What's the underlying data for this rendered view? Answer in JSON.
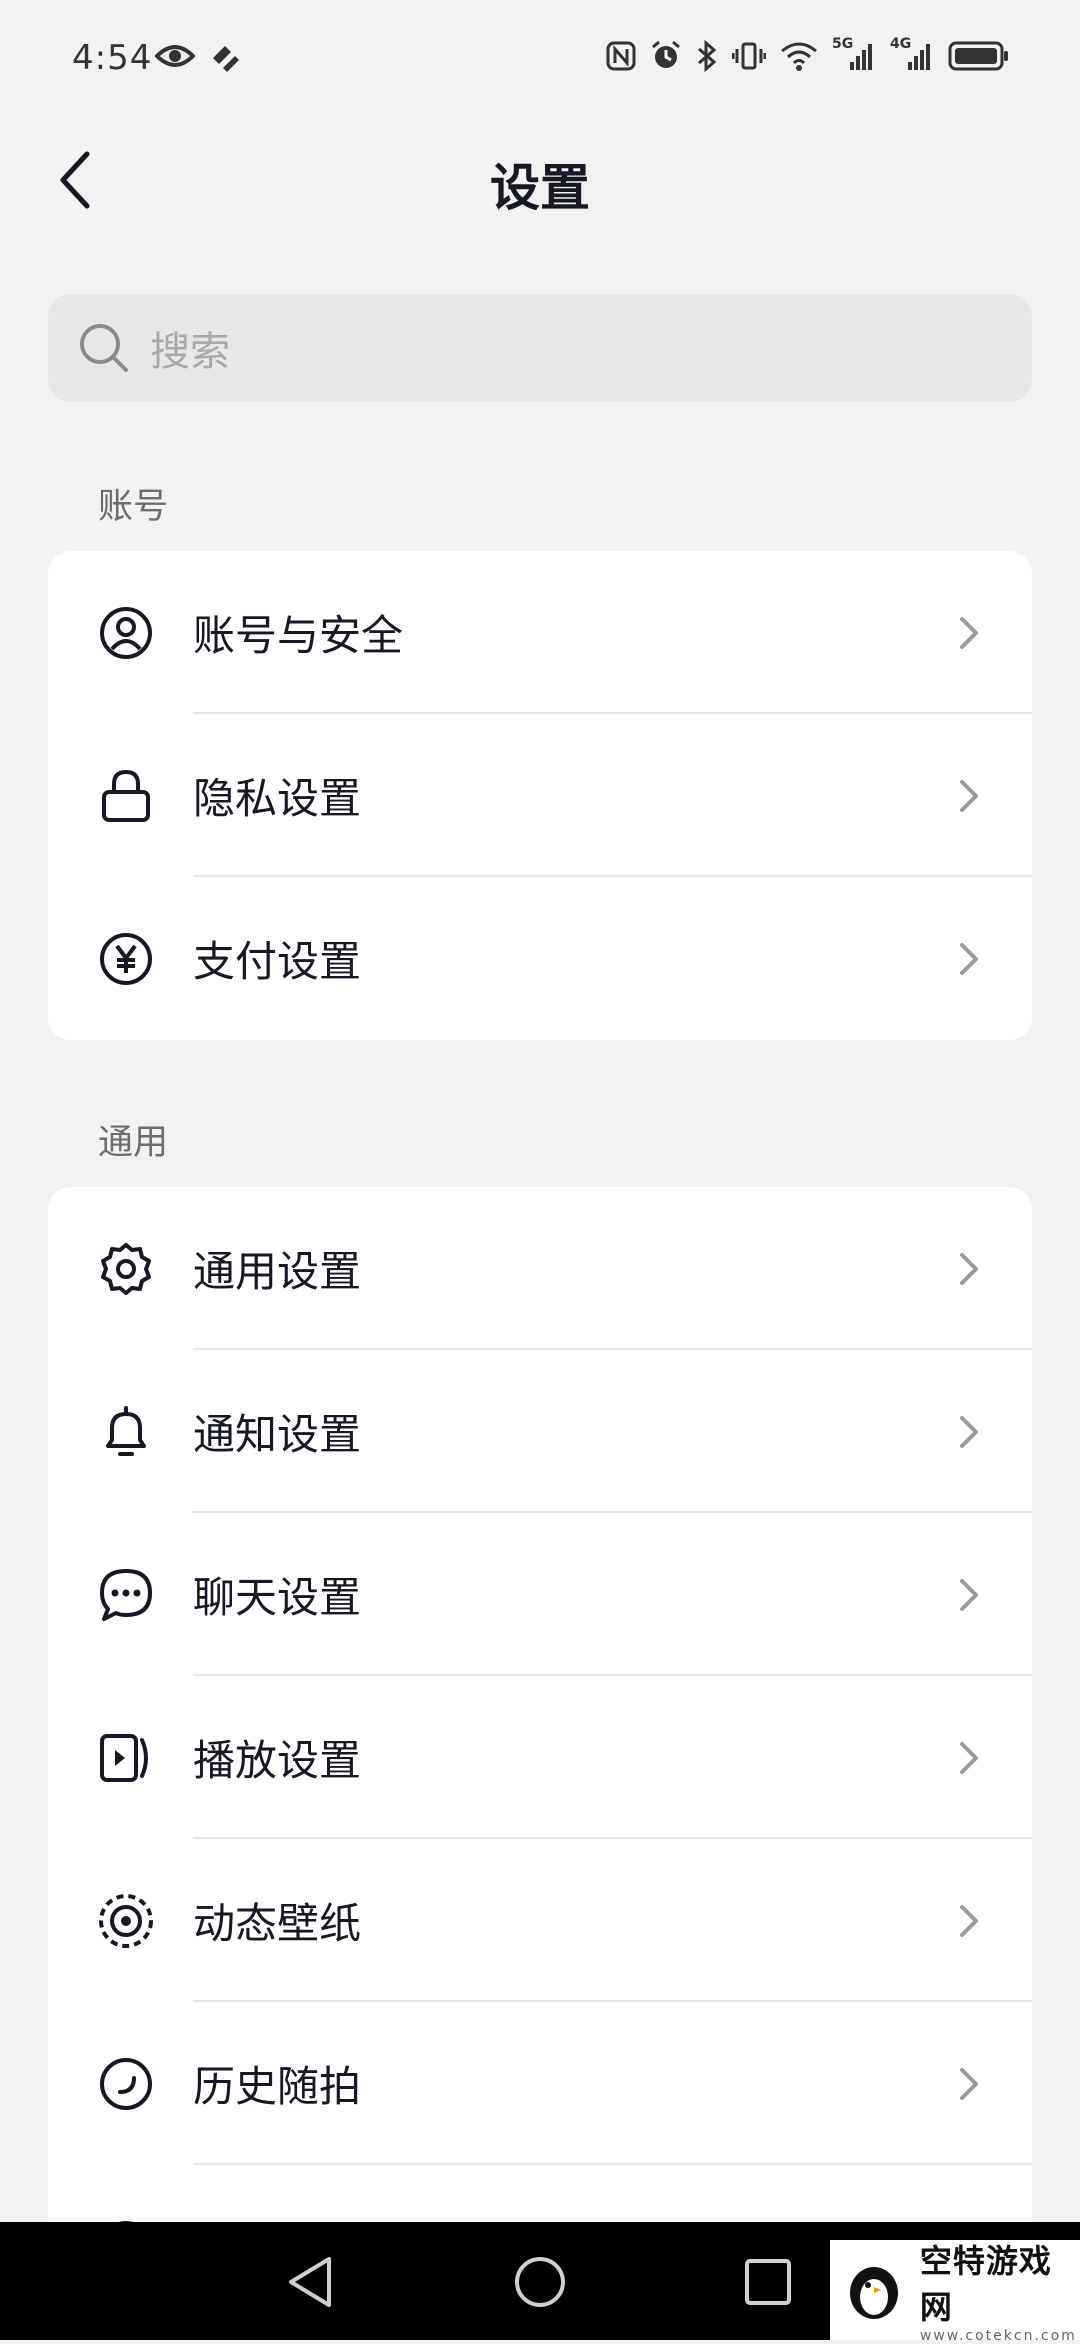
{
  "status_bar": {
    "time": "4:54",
    "signal_1": "5G",
    "signal_2": "4G"
  },
  "header": {
    "title": "设置"
  },
  "search": {
    "placeholder": "搜索"
  },
  "sections": [
    {
      "label": "账号",
      "items": [
        {
          "label": "账号与安全",
          "icon": "user-circle-icon"
        },
        {
          "label": "隐私设置",
          "icon": "lock-icon"
        },
        {
          "label": "支付设置",
          "icon": "yen-icon"
        }
      ]
    },
    {
      "label": "通用",
      "items": [
        {
          "label": "通用设置",
          "icon": "gear-icon"
        },
        {
          "label": "通知设置",
          "icon": "bell-icon"
        },
        {
          "label": "聊天设置",
          "icon": "chat-bubble-icon"
        },
        {
          "label": "播放设置",
          "icon": "play-settings-icon"
        },
        {
          "label": "动态壁纸",
          "icon": "dynamic-wallpaper-icon"
        },
        {
          "label": "历史随拍",
          "icon": "history-icon"
        }
      ]
    }
  ],
  "watermark": {
    "name": "空特游戏网",
    "url": "www.cotekcn.com"
  },
  "colors": {
    "background": "#f2f2f2",
    "card": "#ffffff",
    "text": "#161823",
    "secondary": "#6b6c70",
    "nav_bar": "#000000"
  }
}
